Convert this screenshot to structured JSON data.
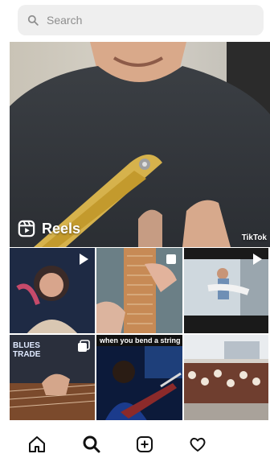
{
  "search": {
    "placeholder": "Search",
    "icon": "search-icon"
  },
  "featured": {
    "label": "Reels",
    "label_icon": "reels-icon",
    "watermark": "TikTok"
  },
  "grid": {
    "caption": "when you bend a string",
    "overlay_text": "BLUES TRADE"
  },
  "nav": {
    "items": [
      {
        "name": "home",
        "icon": "home-icon"
      },
      {
        "name": "search",
        "icon": "search-icon"
      },
      {
        "name": "create",
        "icon": "add-post-icon"
      },
      {
        "name": "activity",
        "icon": "heart-icon"
      }
    ]
  }
}
